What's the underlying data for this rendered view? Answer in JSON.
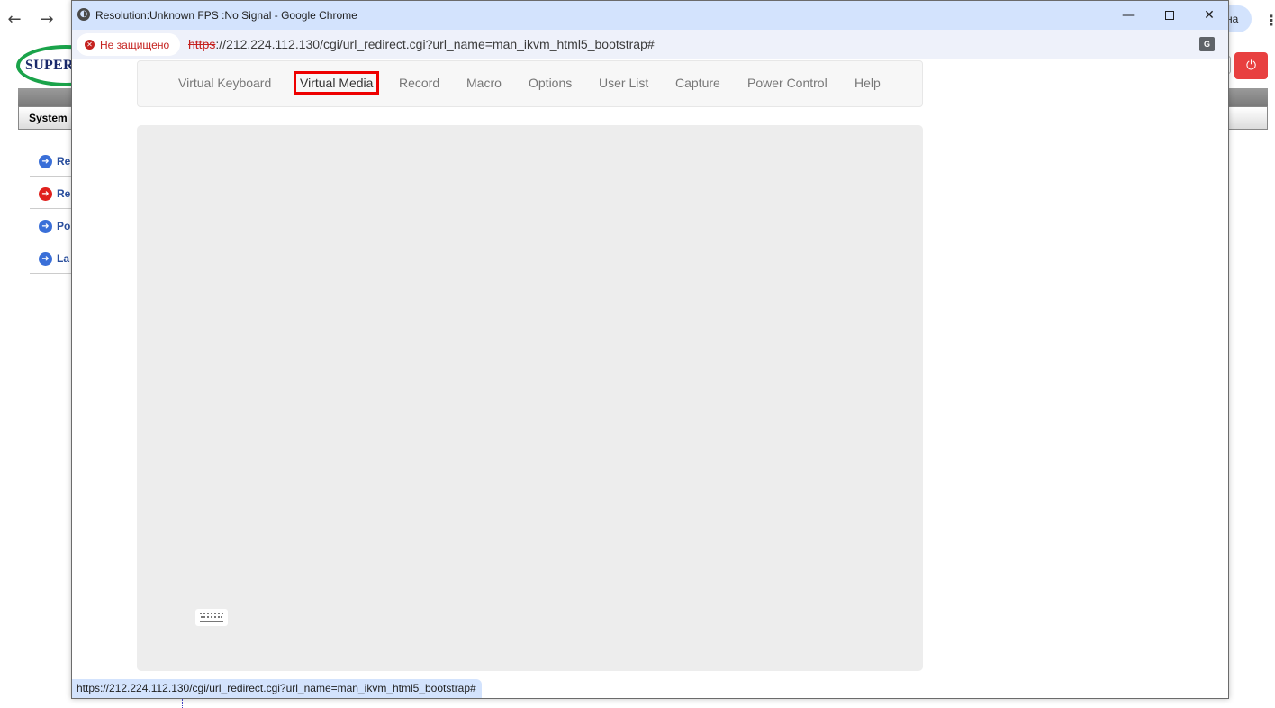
{
  "background_browser": {
    "back_icon": "←",
    "forward_icon": "→",
    "profile_label": "на",
    "menu_icon": "⋮"
  },
  "supermicro_page": {
    "logo_text": "SUPERM",
    "tab_label": "System",
    "power_icon": "⏻",
    "list_items": [
      {
        "label": "Re",
        "icon_color": "#3a6fd8"
      },
      {
        "label": "Re",
        "icon_color": "#e0201c"
      },
      {
        "label": "Po",
        "icon_color": "#3a6fd8"
      },
      {
        "label": "La",
        "icon_color": "#3a6fd8"
      }
    ]
  },
  "popup": {
    "window_title": "Resolution:Unknown FPS :No Signal - Google Chrome",
    "minimize_icon": "—",
    "close_icon": "✕",
    "security_label": "Не защищено",
    "url_scheme": "https",
    "url_rest": "://212.224.112.130/cgi/url_redirect.cgi?url_name=man_ikvm_html5_bootstrap#",
    "translate_icon": "G",
    "status_url": "https://212.224.112.130/cgi/url_redirect.cgi?url_name=man_ikvm_html5_bootstrap#"
  },
  "kvm_menu": {
    "items": [
      {
        "label": "Virtual Keyboard",
        "active": false
      },
      {
        "label": "Virtual Media",
        "active": true
      },
      {
        "label": "Record",
        "active": false
      },
      {
        "label": "Macro",
        "active": false
      },
      {
        "label": "Options",
        "active": false
      },
      {
        "label": "User List",
        "active": false
      },
      {
        "label": "Capture",
        "active": false
      },
      {
        "label": "Power Control",
        "active": false
      },
      {
        "label": "Help",
        "active": false
      }
    ]
  },
  "colors": {
    "highlight": "#e00000",
    "insecure": "#c5221f",
    "chrome_frame": "#d3e3fd"
  }
}
